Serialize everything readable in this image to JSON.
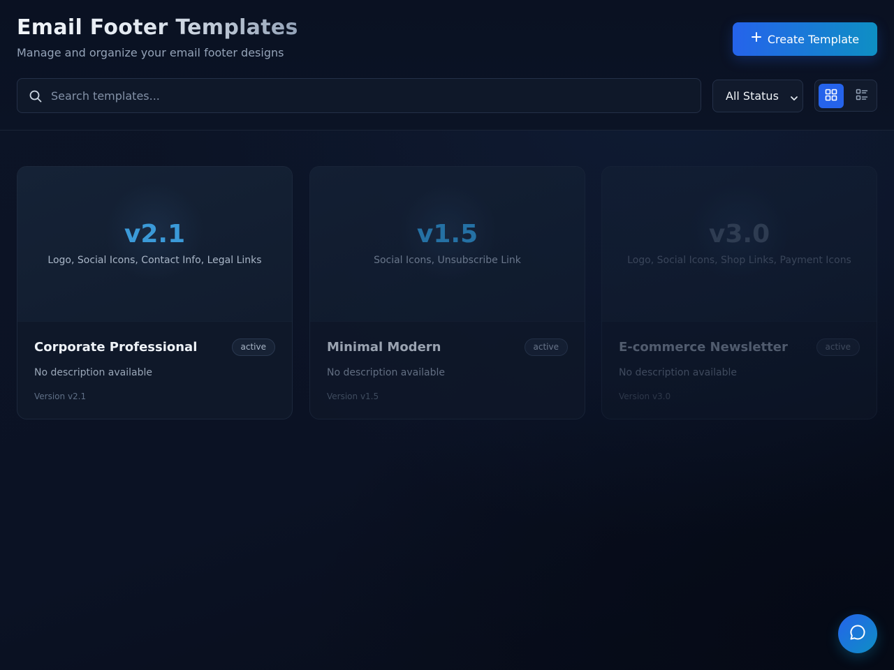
{
  "header": {
    "title": "Email Footer Templates",
    "subtitle": "Manage and organize your email footer designs",
    "create_button": {
      "label": "Create Template",
      "icon": "plus-icon"
    }
  },
  "toolbar": {
    "search": {
      "placeholder": "Search templates...",
      "value": "",
      "icon": "search-icon"
    },
    "status_filter": {
      "selected": "All Status"
    },
    "view_toggle": {
      "active": "grid",
      "options": [
        "grid",
        "list"
      ]
    }
  },
  "templates": [
    {
      "version_big": "v2.1",
      "features": "Logo, Social Icons, Contact Info, Legal Links",
      "name": "Corporate Professional",
      "status": "active",
      "description": "No description available",
      "version_label": "Version v2.1"
    },
    {
      "version_big": "v1.5",
      "features": "Social Icons, Unsubscribe Link",
      "name": "Minimal Modern",
      "status": "active",
      "description": "No description available",
      "version_label": "Version v1.5"
    },
    {
      "version_big": "v3.0",
      "features": "Logo, Social Icons, Shop Links, Payment Icons",
      "name": "E-commerce Newsletter",
      "status": "active",
      "description": "No description available",
      "version_label": "Version v3.0"
    }
  ],
  "chat": {
    "icon": "chat-bubble-icon"
  },
  "colors": {
    "accent": "#2563eb",
    "accent_secondary": "#0e8fc4",
    "background": "#0b1120",
    "card": "#0f1829"
  }
}
